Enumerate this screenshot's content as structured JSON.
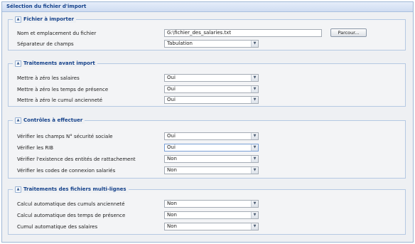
{
  "panel": {
    "title": "Sélection du fichier d'import"
  },
  "sections": {
    "file": {
      "title": "Fichier à importer",
      "path_label": "Nom et emplacement du fichier",
      "path_value": "G:\\fichier_des_salaries.txt",
      "browse_label": "Parcour...",
      "separator_label": "Séparateur de champs",
      "separator_value": "Tabulation"
    },
    "pre_import": {
      "title": "Traitements avant import",
      "rows": [
        {
          "label": "Mettre à zéro les salaires",
          "value": "Oui"
        },
        {
          "label": "Mettre à zéro les temps de présence",
          "value": "Oui"
        },
        {
          "label": "Mettre à zéro le cumul ancienneté",
          "value": "Oui"
        }
      ]
    },
    "checks": {
      "title": "Contrôles à effectuer",
      "rows": [
        {
          "label": "Vérifier les champs N° sécurité sociale",
          "value": "Oui"
        },
        {
          "label": "Vérifier les RIB",
          "value": "Oui"
        },
        {
          "label": "Vérifier l'existence des entités de rattachement",
          "value": "Non"
        },
        {
          "label": "Vérifier les codes de connexion salariés",
          "value": "Non"
        }
      ]
    },
    "multiline": {
      "title": "Traitements des fichiers multi-lignes",
      "rows": [
        {
          "label": "Calcul automatique des cumuls ancienneté",
          "value": "Non"
        },
        {
          "label": "Calcul automatique des temps de présence",
          "value": "Non"
        },
        {
          "label": "Cumul automatique des salaires",
          "value": "Non"
        }
      ]
    }
  },
  "icons": {
    "collapse": "collapse-up-icon",
    "dropdown": "chevron-down-icon"
  }
}
